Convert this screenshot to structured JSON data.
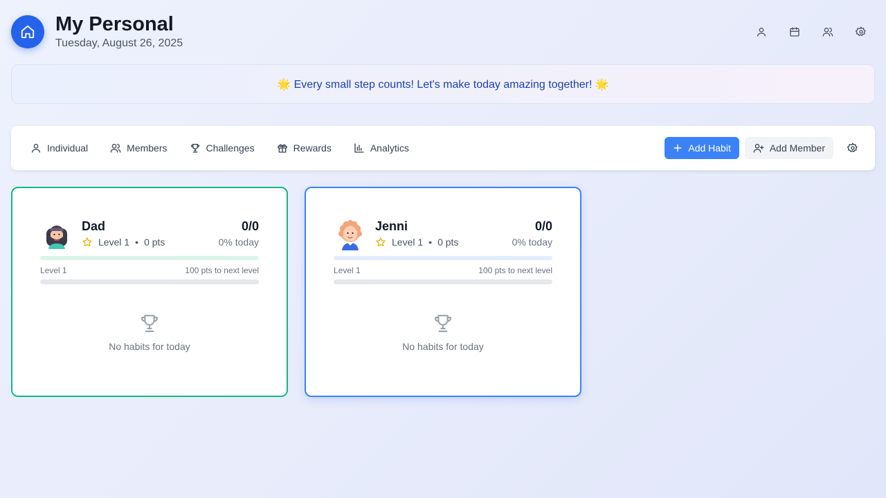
{
  "app": {
    "title": "My Personal",
    "date": "Tuesday, August 26, 2025",
    "accent": "#2563eb"
  },
  "header_icons": [
    "user-icon",
    "calendar-icon",
    "users-icon",
    "gear-icon"
  ],
  "banner": {
    "text": "🌟 Every small step counts! Let's make today amazing together! 🌟"
  },
  "nav": {
    "items": [
      {
        "label": "Individual",
        "icon": "user-icon"
      },
      {
        "label": "Members",
        "icon": "users-icon"
      },
      {
        "label": "Challenges",
        "icon": "trophy-icon"
      },
      {
        "label": "Rewards",
        "icon": "gift-icon"
      },
      {
        "label": "Analytics",
        "icon": "bar-chart-icon"
      }
    ]
  },
  "actions": {
    "add_habit": "Add Habit",
    "add_member": "Add Member"
  },
  "members": [
    {
      "name": "Dad",
      "level": "Level 1",
      "points": "0 pts",
      "score": "0/0",
      "today": "0% today",
      "level_label": "Level 1",
      "next_level": "100 pts to next level",
      "empty_text": "No habits for today",
      "border_color": "#10b981",
      "today_progress": 0,
      "level_progress": 0
    },
    {
      "name": "Jenni",
      "level": "Level 1",
      "points": "0 pts",
      "score": "0/0",
      "today": "0% today",
      "level_label": "Level 1",
      "next_level": "100 pts to next level",
      "empty_text": "No habits for today",
      "border_color": "#3b82f6",
      "today_progress": 0,
      "level_progress": 0
    }
  ]
}
